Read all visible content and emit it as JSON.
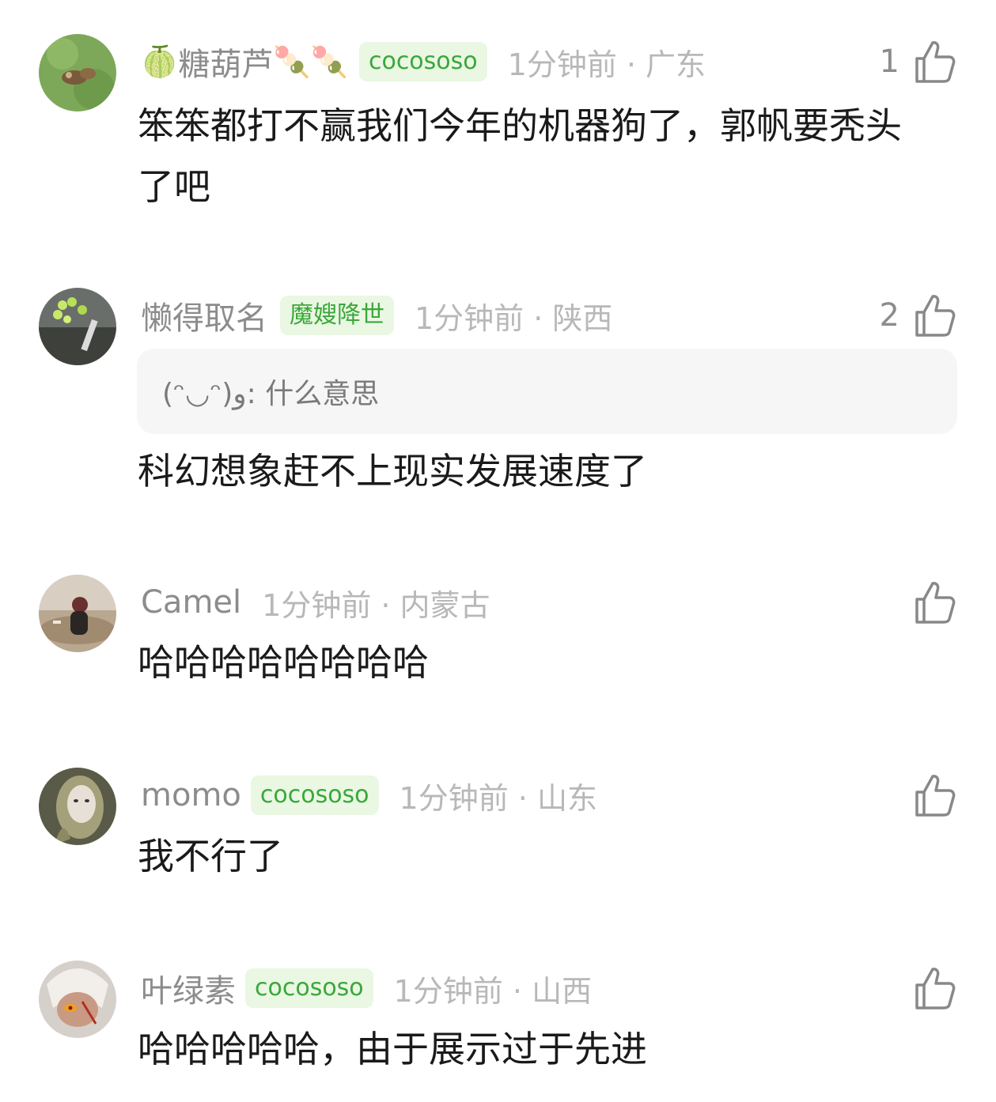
{
  "comments": [
    {
      "username": "糖葫芦",
      "name_emoji_prefix": "🍈",
      "name_emoji_suffix": "🍡🍡",
      "badge": "cocososo",
      "meta": "1分钟前 · 广东",
      "likes": "1",
      "text": "笨笨都打不赢我们今年的机器狗了，郭帆要秃头了吧"
    },
    {
      "username": "懒得取名",
      "badge": "魔嫂降世",
      "meta": "1分钟前 · 陕西",
      "likes": "2",
      "quote": "(ᵔ◡ᵔ)و: 什么意思",
      "text": "科幻想象赶不上现实发展速度了"
    },
    {
      "username": "Camel",
      "meta": "1分钟前 · 内蒙古",
      "likes": "",
      "text": "哈哈哈哈哈哈哈哈"
    },
    {
      "username": "momo",
      "badge": "cocososo",
      "meta": "1分钟前 · 山东",
      "likes": "",
      "text": "我不行了"
    },
    {
      "username": "叶绿素",
      "badge": "cocososo",
      "meta": "1分钟前 · 山西",
      "likes": "",
      "text": "哈哈哈哈哈，由于展示过于先进"
    }
  ],
  "colors": {
    "badge_bg": "#eaf7e3",
    "badge_text": "#3aa83a",
    "username": "#8c8c8c",
    "meta": "#b8b8b8",
    "body_text": "#1a1a1a"
  },
  "icons": {
    "like": "thumbs-up-icon"
  }
}
